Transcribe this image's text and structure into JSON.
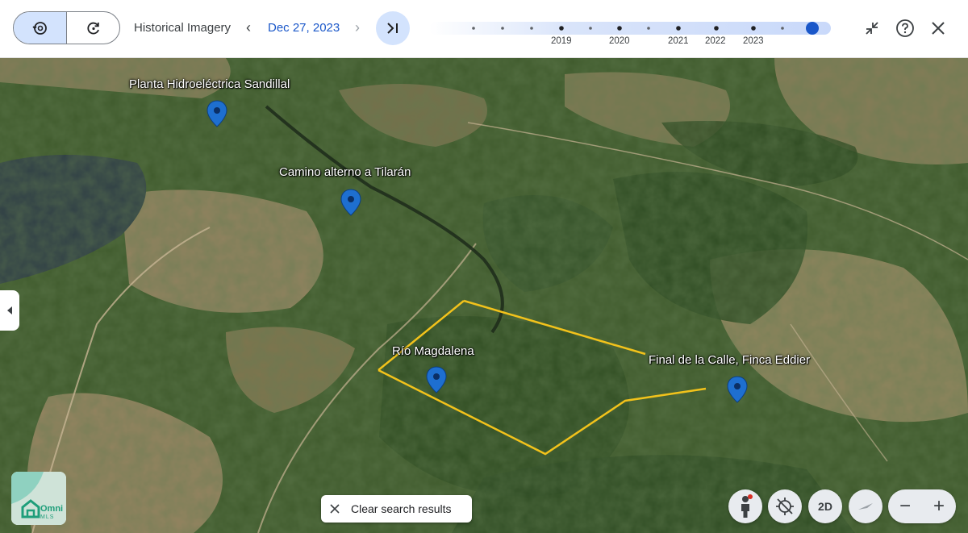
{
  "toolbar": {
    "title": "Historical Imagery",
    "date": "Dec 27, 2023",
    "timeline_years": [
      "2019",
      "2020",
      "2021",
      "2022",
      "2023"
    ],
    "icons": [
      "history-icon",
      "refresh-icon",
      "chevron-left-icon",
      "chevron-right-icon",
      "jump-to-latest-icon",
      "collapse-icon",
      "help-icon",
      "close-icon"
    ]
  },
  "map": {
    "places": [
      {
        "name": "Planta Hidroeléctrica Sandillal"
      },
      {
        "name": "Camino alterno a Tilarán"
      },
      {
        "name": "Río Magdalena"
      },
      {
        "name": "Final de la Calle, Finca Eddier"
      }
    ],
    "boundary_color": "#f2c21b",
    "pin_color": "#1e6fd0"
  },
  "controls": {
    "clear_search": "Clear search results",
    "view_2d": "2D",
    "zoom_out": "−",
    "zoom_in": "+",
    "logo_text": "Omni",
    "logo_subtext": "MLS"
  }
}
